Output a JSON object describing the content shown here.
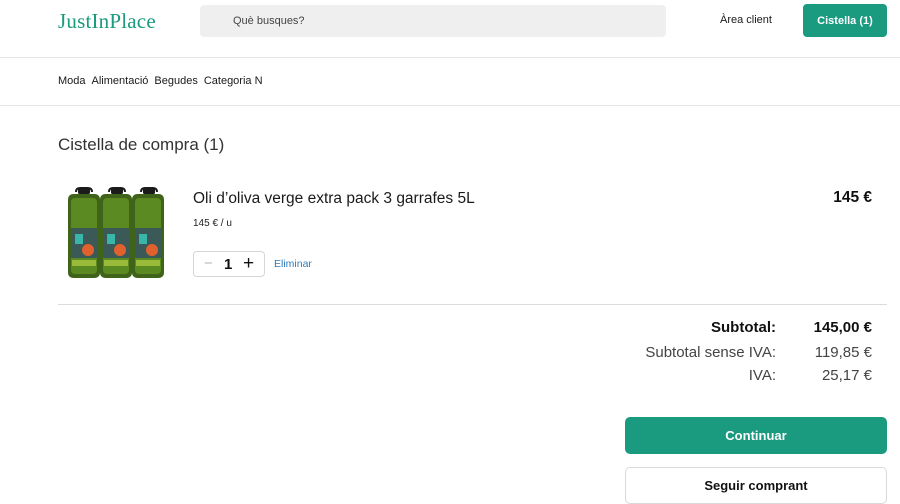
{
  "header": {
    "logo": "JustInPlace",
    "search_placeholder": "Què busques?",
    "account_link": "Àrea client",
    "cart_button": "Cistella (1)"
  },
  "nav": {
    "items": [
      "Moda",
      "Alimentació",
      "Begudes",
      "Categoria N"
    ]
  },
  "cart": {
    "title": "Cistella de compra (1)",
    "items": [
      {
        "name": "Oli d’oliva verge extra pack 3 garrafes 5L",
        "unit_price": "145 € / u",
        "quantity": "1",
        "qty_minus": "−",
        "qty_plus": "+",
        "remove_label": "Eliminar",
        "line_total": "145 €"
      }
    ]
  },
  "summary": {
    "subtotal_label": "Subtotal:",
    "subtotal_value": "145,00 €",
    "net_label": "Subtotal sense IVA:",
    "net_value": "119,85 €",
    "vat_label": "IVA:",
    "vat_value": "25,17 €"
  },
  "actions": {
    "continue_label": "Continuar",
    "keep_shopping_label": "Seguir comprant"
  },
  "colors": {
    "brand": "#1a9a7e",
    "link": "#2f7bb8"
  },
  "icons": {
    "product_image": "olive-oil-bottles-image"
  }
}
